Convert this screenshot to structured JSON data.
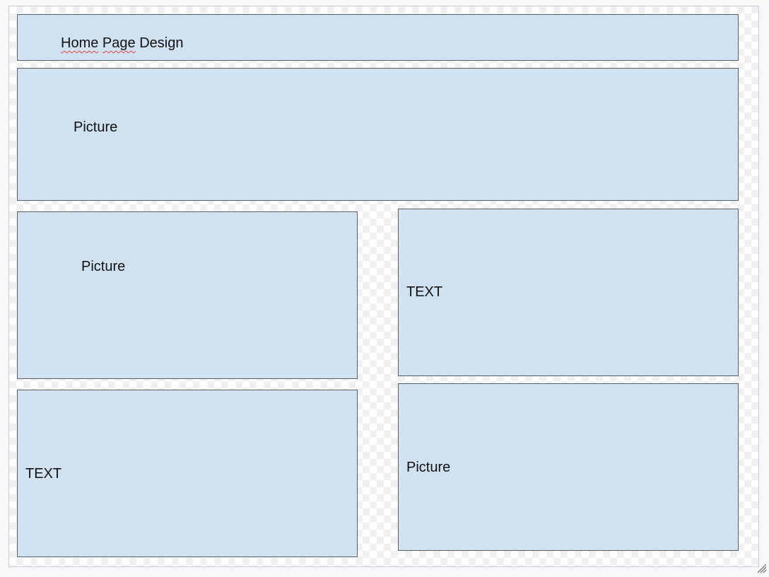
{
  "header": {
    "word1": "Home",
    "word2": "Page",
    "word3": "Design"
  },
  "hero": {
    "label": "Picture"
  },
  "middle_left": {
    "label": "Picture"
  },
  "middle_right": {
    "label": "TEXT"
  },
  "bottom_left": {
    "label": "TEXT"
  },
  "bottom_right": {
    "label": "Picture"
  },
  "icons": {
    "resize": "resize-grip-icon"
  },
  "colors": {
    "box_fill": "#d0e1f1",
    "box_border": "#5a5e63",
    "spellcheck_underline": "#e0403a"
  }
}
